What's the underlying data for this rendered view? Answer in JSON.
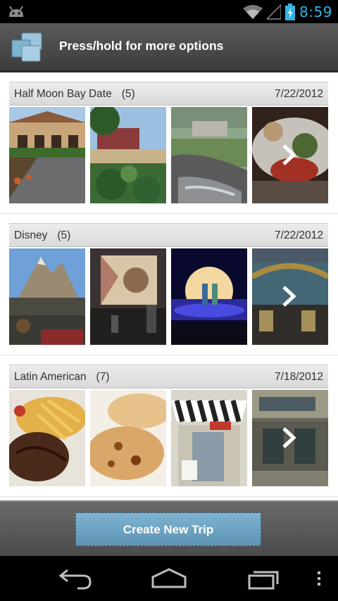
{
  "status_bar": {
    "time": "8:59"
  },
  "action_bar": {
    "title": "Press/hold for more options"
  },
  "trips": [
    {
      "name": "Half Moon Bay Date",
      "count": "(5)",
      "date": "7/22/2012"
    },
    {
      "name": "Disney",
      "count": "(5)",
      "date": "7/22/2012"
    },
    {
      "name": "Latin American",
      "count": "(7)",
      "date": "7/18/2012"
    }
  ],
  "bottom": {
    "create_label": "Create New Trip"
  },
  "colors": {
    "accent": "#33b5e5",
    "button": "#6fa4c4",
    "actionbar": "#4a4a4a"
  },
  "icons": [
    "android-icon",
    "wifi-icon",
    "signal-icon",
    "battery-icon",
    "app-logo-icon",
    "chevron-right-icon",
    "back-icon",
    "home-icon",
    "recent-apps-icon",
    "overflow-menu-icon"
  ]
}
